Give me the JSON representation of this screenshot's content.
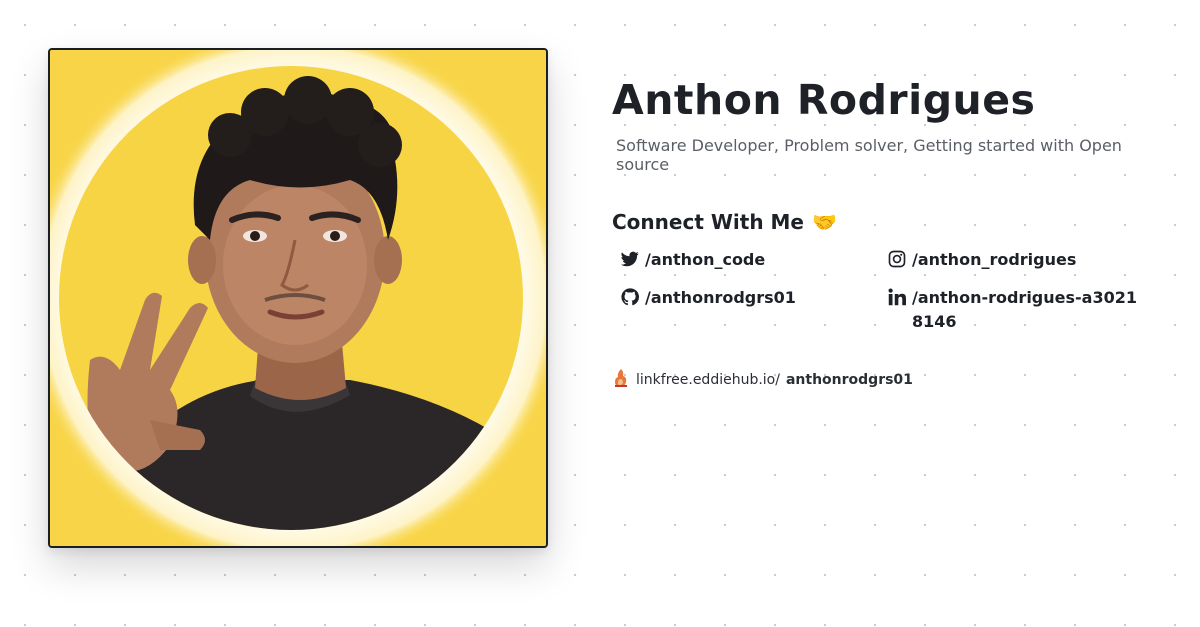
{
  "profile": {
    "name": "Anthon Rodrigues",
    "bio": "Software Developer, Problem solver, Getting started with Open source"
  },
  "connect": {
    "heading": "Connect With Me",
    "emoji": "🤝"
  },
  "socials": [
    {
      "icon": "twitter-icon",
      "handle": "/anthon_code"
    },
    {
      "icon": "instagram-icon",
      "handle": "/anthon_rodrigues"
    },
    {
      "icon": "github-icon",
      "handle": "/anthonrodgrs01"
    },
    {
      "icon": "linkedin-icon",
      "handle": "/anthon-rodrigues-a30218146"
    }
  ],
  "footer": {
    "prefix": "linkfree.eddiehub.io/",
    "username": "anthonrodgrs01",
    "icon": "linkfree-logo-icon"
  },
  "colors": {
    "background": "#ffffff",
    "photo_background": "#f8d548",
    "text": "#1e2228",
    "muted": "#5a5f66"
  }
}
